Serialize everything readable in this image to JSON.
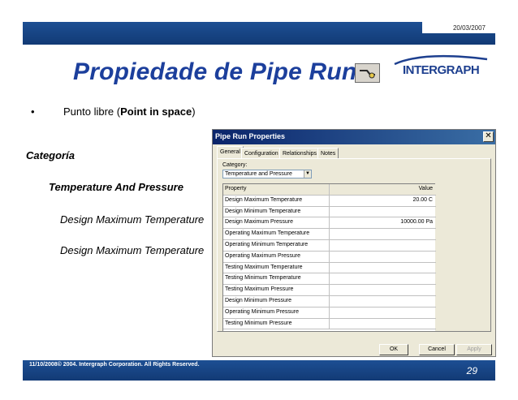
{
  "header": {
    "date": "20/03/2007"
  },
  "slide": {
    "title": "Propiedade de Pipe Run",
    "logo_text": "INTERGRAPH",
    "bullet_marker": "•",
    "bullet_text_pre": "Punto libre (",
    "bullet_text_bold": "Point in space",
    "bullet_text_post": ")",
    "label_category": "Categoría",
    "label_temp_pressure": "Temperature And Pressure",
    "label_dmt_1": "Design Maximum Temperature",
    "label_dmt_2": "Design Maximum Temperature"
  },
  "dialog": {
    "title": "Pipe Run Properties",
    "close_glyph": "✕",
    "tabs": [
      "General",
      "Configuration",
      "Relationships",
      "Notes"
    ],
    "category_label": "Category:",
    "category_value": "Temperature and Pressure",
    "dropdown_glyph": "▼",
    "grid_header": {
      "property": "Property",
      "value": "Value"
    },
    "rows": [
      {
        "property": "Design Maximum Temperature",
        "value": "20.00 C"
      },
      {
        "property": "Design Minimum Temperature",
        "value": ""
      },
      {
        "property": "Design Maximum Pressure",
        "value": "10000.00 Pa"
      },
      {
        "property": "Operating Maximum Temperature",
        "value": ""
      },
      {
        "property": "Operating Minimum Temperature",
        "value": ""
      },
      {
        "property": "Operating Maximum Pressure",
        "value": ""
      },
      {
        "property": "Testing Maximum Temperature",
        "value": ""
      },
      {
        "property": "Testing Minimum Temperature",
        "value": ""
      },
      {
        "property": "Testing Maximum Pressure",
        "value": ""
      },
      {
        "property": "Design Minimum Pressure",
        "value": ""
      },
      {
        "property": "Operating Minimum Pressure",
        "value": ""
      },
      {
        "property": "Testing Minimum Pressure",
        "value": ""
      }
    ],
    "buttons": {
      "ok": "OK",
      "cancel": "Cancel",
      "apply": "Apply"
    }
  },
  "footer": {
    "copyright": "11/10/2008© 2004. Intergraph Corporation. All Rights Reserved.",
    "page_number": "29"
  },
  "colors": {
    "brand_blue": "#1d4f93",
    "title_blue": "#1c3f9c",
    "dialog_face": "#ece9d8"
  },
  "icons": {
    "pipe_run": "pipe-run-icon",
    "close": "close-icon"
  }
}
